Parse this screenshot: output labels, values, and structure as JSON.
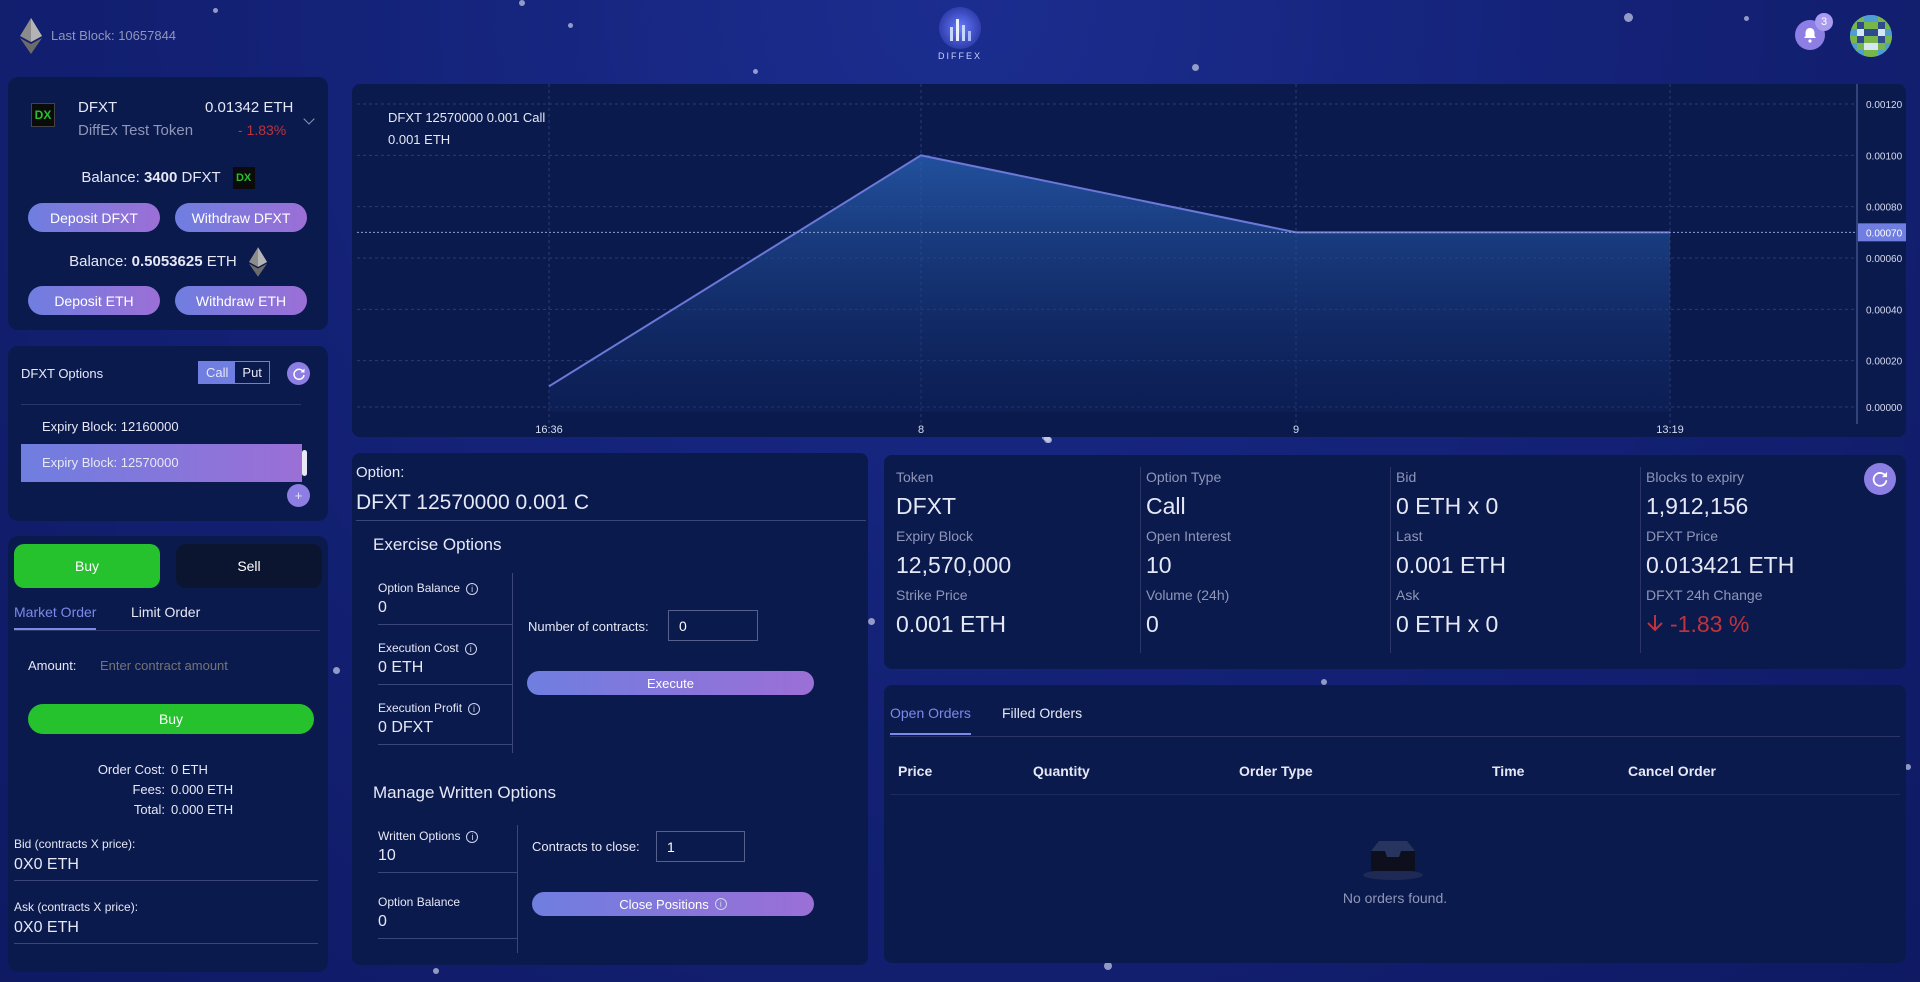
{
  "header": {
    "last_block": "Last Block: 10657844",
    "logo_text": "DIFFEX",
    "notification_count": "3"
  },
  "token_panel": {
    "symbol": "DFXT",
    "name": "DiffEx Test Token",
    "price": "0.01342 ETH",
    "change": "- 1.83%",
    "logo_text": "DX",
    "balance_label": "Balance:",
    "token_balance": "3400",
    "token_unit": "DFXT",
    "eth_balance": "0.5053625",
    "eth_unit": "ETH",
    "deposit_token": "Deposit DFXT",
    "withdraw_token": "Withdraw DFXT",
    "deposit_eth": "Deposit ETH",
    "withdraw_eth": "Withdraw ETH"
  },
  "options_panel": {
    "title": "DFXT Options",
    "call_label": "Call",
    "put_label": "Put",
    "expiries": [
      "Expiry Block: 12160000",
      "Expiry Block: 12570000"
    ],
    "add_label": "+"
  },
  "trade_panel": {
    "buy_tab": "Buy",
    "sell_tab": "Sell",
    "market_order": "Market Order",
    "limit_order": "Limit Order",
    "amount_label": "Amount:",
    "amount_placeholder": "Enter contract amount",
    "buy_button": "Buy",
    "order_cost_label": "Order Cost:",
    "order_cost_value": "0 ETH",
    "fees_label": "Fees:",
    "fees_value": "0.000 ETH",
    "total_label": "Total:",
    "total_value": "0.000 ETH",
    "bid_label": "Bid (contracts X price):",
    "bid_value": "0X0 ETH",
    "ask_label": "Ask (contracts X price):",
    "ask_value": "0X0 ETH"
  },
  "chart_data": {
    "type": "area",
    "title": "DFXT 12570000 0.001 Call",
    "subtitle": "0.001 ETH",
    "x": [
      "16:36",
      "8",
      "9",
      "13:19"
    ],
    "series": [
      {
        "values": [
          0.0001,
          0.001,
          0.0007,
          0.0007
        ]
      }
    ],
    "y_ticks": [
      "0.00000",
      "0.00020",
      "0.00040",
      "0.00060",
      "0.00080",
      "0.00100",
      "0.00120"
    ],
    "current_value": "0.00070",
    "ylim": [
      0,
      0.0012
    ],
    "grid": true,
    "line_color": "#6b78d8"
  },
  "option_panel": {
    "label": "Option:",
    "name": "DFXT 12570000 0.001 C",
    "exercise_title": "Exercise Options",
    "option_balance_label": "Option Balance",
    "option_balance": "0",
    "execution_cost_label": "Execution Cost",
    "execution_cost": "0 ETH",
    "execution_profit_label": "Execution Profit",
    "execution_profit": "0 DFXT",
    "contracts_label": "Number of contracts:",
    "contracts_value": "0",
    "execute_button": "Execute",
    "manage_title": "Manage Written Options",
    "written_label": "Written Options",
    "written_value": "10",
    "option_balance2_label": "Option Balance",
    "option_balance2": "0",
    "close_label": "Contracts to close:",
    "close_value": "1",
    "close_button": "Close Positions",
    "info_glyph": "i"
  },
  "stats": [
    [
      {
        "label": "Token",
        "value": "DFXT"
      },
      {
        "label": "Expiry Block",
        "value": "12,570,000"
      },
      {
        "label": "Strike Price",
        "value": "0.001 ETH"
      }
    ],
    [
      {
        "label": "Option Type",
        "value": "Call"
      },
      {
        "label": "Open Interest",
        "value": "10"
      },
      {
        "label": "Volume (24h)",
        "value": "0"
      }
    ],
    [
      {
        "label": "Bid",
        "value": "0 ETH x 0"
      },
      {
        "label": "Last",
        "value": "0.001 ETH"
      },
      {
        "label": "Ask",
        "value": "0 ETH x 0"
      }
    ],
    [
      {
        "label": "Blocks to expiry",
        "value": "1,912,156"
      },
      {
        "label": "DFXT Price",
        "value": "0.013421 ETH"
      },
      {
        "label": "DFXT 24h Change",
        "value": "-1.83 %"
      }
    ]
  ],
  "orders_panel": {
    "tabs": [
      "Open Orders",
      "Filled Orders"
    ],
    "columns": [
      "Price",
      "Quantity",
      "Order Type",
      "Time",
      "Cancel Order"
    ],
    "empty": "No orders found."
  },
  "colors": {
    "accent": "#7b7fe0",
    "buy_green": "#25c22d",
    "negative_red": "#c0323c"
  }
}
